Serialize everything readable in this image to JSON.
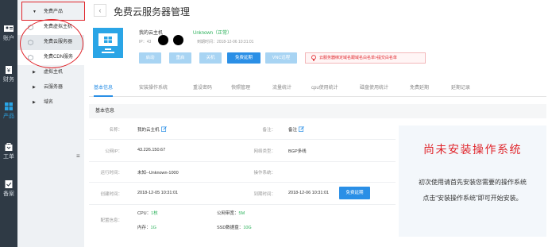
{
  "rail": [
    {
      "label": "账户",
      "icon": "account-icon"
    },
    {
      "label": "财务",
      "icon": "finance-icon"
    },
    {
      "label": "产品",
      "icon": "product-icon",
      "active": true
    },
    {
      "label": "工单",
      "icon": "ticket-icon"
    },
    {
      "label": "备案",
      "icon": "record-icon"
    }
  ],
  "sidebar": {
    "free_group": "免费产品",
    "free_items": [
      "免费虚拟主机",
      "免费云服务器",
      "免费CDN服务"
    ],
    "groups": [
      "虚拟主机",
      "云服务器",
      "域名"
    ]
  },
  "page": {
    "title": "免费云服务器管理",
    "back_icon": "chevron-left-icon"
  },
  "server": {
    "name": "我的云主机",
    "status": "Unknown（正常）",
    "ip_prefix": "IP：43",
    "expire": "到期时间：2018-12-06 10:31:01",
    "buttons": {
      "start": "启动",
      "restart": "重启",
      "shutdown": "关机",
      "renew": "免费延期",
      "vnc": "VNC远程"
    },
    "notice": "云服务器绑定域名跟域名白名单>提交白名单"
  },
  "tabs": [
    "基本信息",
    "安装操作系统",
    "重设密码",
    "快照管理",
    "流量统计",
    "cpu使用统计",
    "磁盘使用统计",
    "免费延期",
    "延期记录"
  ],
  "info": {
    "section": "基本信息",
    "name_label": "名称：",
    "name_value": "我的云主机",
    "remark_label": "备注：",
    "remark_value": "备注",
    "ip_label": "公网IP：",
    "ip_value": "43.226.150.67",
    "nettype_label": "网络类型：",
    "nettype_value": "BGP多线",
    "runtime_label": "运行时间：",
    "runtime_value": "未知--Unknown-1000",
    "os_label": "操作系统：",
    "os_value": "",
    "created_label": "创建时间：",
    "created_value": "2018-12-05 10:31:01",
    "expire_label": "到期时间：",
    "expire_value": "2018-12-06 10:31:01",
    "renew_button": "免费延期",
    "config_label": "配置信息：",
    "cpu_label": "CPU：",
    "cpu_value": "1核",
    "mem_label": "内存：",
    "mem_value": "1G",
    "bw_label": "公网带宽：",
    "bw_value": "5M",
    "disk_label": "SSD数据盘：",
    "disk_value": "10G"
  },
  "os_panel": {
    "title": "尚未安装操作系统",
    "line1": "初次使用请首先安装您需要的操作系统",
    "line2": "点击“安装操作系统”即可开始安装。"
  }
}
